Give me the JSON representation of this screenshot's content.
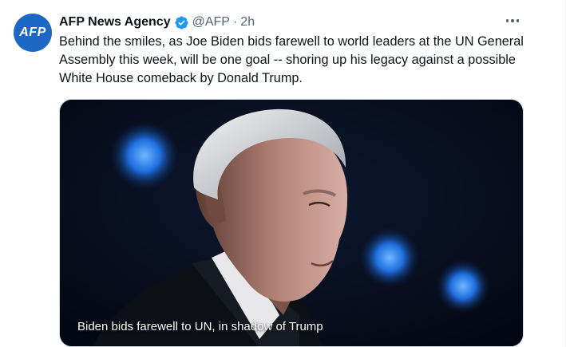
{
  "tweet": {
    "avatar_text": "AFP",
    "display_name": "AFP News Agency",
    "handle": "@AFP",
    "separator": "·",
    "time": "2h",
    "body": "Behind the smiles, as Joe Biden bids farewell to world leaders at the UN General Assembly this week, will be one goal -- shoring up his legacy against a possible White House comeback by Donald Trump.",
    "media_caption": "Biden bids farewell to UN, in shadow of Trump"
  },
  "icons": {
    "verified": "verified-badge-icon",
    "more": "more-options-icon"
  },
  "colors": {
    "avatar_bg": "#1d68c4",
    "verified": "#1d9bf0",
    "secondary_text": "#536471",
    "media_bg": "#050b18"
  }
}
